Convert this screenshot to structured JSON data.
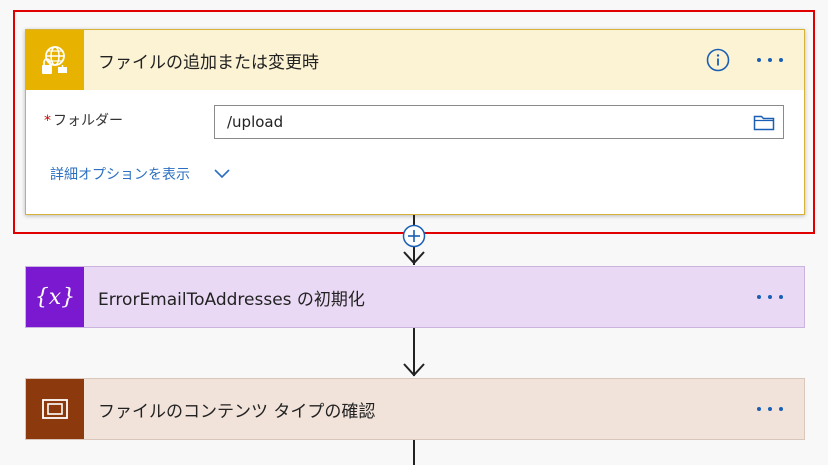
{
  "trigger": {
    "title": "ファイルの追加または変更時",
    "field_required_mark": "*",
    "field_label": "フォルダー",
    "field_value": "/upload",
    "advanced_options": "詳細オプションを表示",
    "icon": "globe-lock-icon",
    "colors": {
      "header_bg": "#fcf3d4",
      "icon_bg": "#e8b300",
      "highlight": "#e00000"
    }
  },
  "steps": [
    {
      "title": "ErrorEmailToAddresses の初期化",
      "icon": "variable-icon",
      "color": "#7a19cf"
    },
    {
      "title": "ファイルのコンテンツ タイプの確認",
      "icon": "content-type-icon",
      "color": "#8c3a0d"
    }
  ],
  "icons": {
    "info": "info-icon",
    "more": "more-icon",
    "folder": "folder-icon",
    "expand": "chevron-down-icon",
    "insert": "plus-circle-icon"
  },
  "var_symbol": "{x}"
}
